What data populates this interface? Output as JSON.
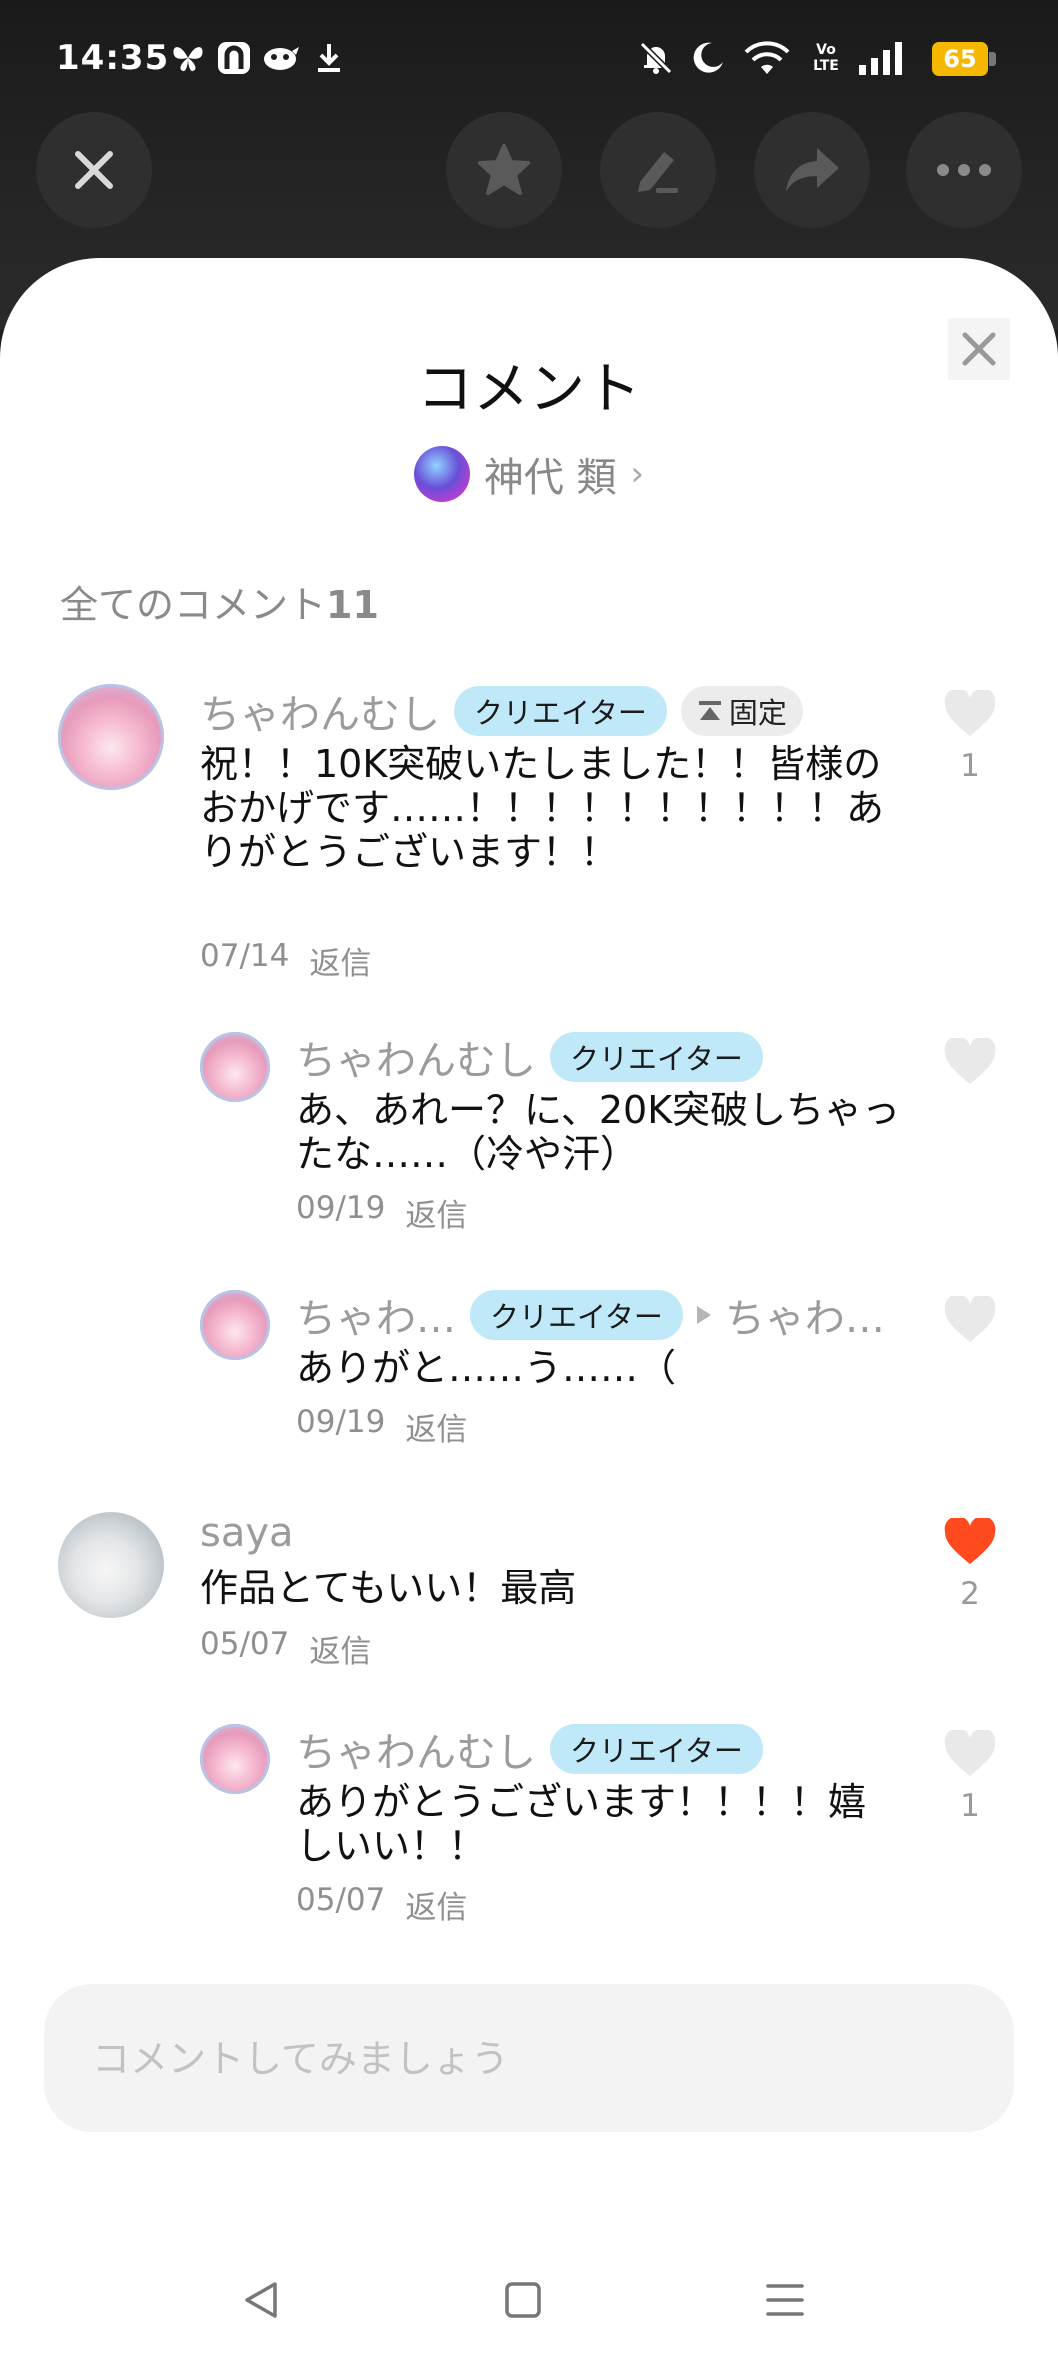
{
  "status_bar": {
    "time": "14:35",
    "battery": "65",
    "icons": [
      "butterfly-icon",
      "app-icon",
      "bird-icon",
      "download-icon",
      "mute-icon",
      "moon-icon",
      "wifi-icon",
      "volte-icon",
      "signal-icon",
      "battery-icon"
    ],
    "volte_text": "Vo LTE"
  },
  "top_actions": [
    "close-icon",
    "star-icon",
    "edit-icon",
    "share-icon",
    "more-icon"
  ],
  "sheet": {
    "title": "コメント",
    "author_name": "神代 類",
    "count_label": "全てのコメント",
    "count_value": "11"
  },
  "badges": {
    "creator": "クリエイター",
    "pinned": "固定"
  },
  "comments": [
    {
      "user": "ちゃわんむし",
      "text": "祝！！10K突破いたしました！！皆様のおかげです……！！！！！！！！！！ありがとうございます！！",
      "date": "07/14",
      "reply_label": "返信",
      "likes": "1",
      "replies": [
        {
          "user": "ちゃわんむし",
          "text": "あ、あれー？に、20K突破しちゃったな……（冷や汗）",
          "date": "09/19",
          "reply_label": "返信"
        },
        {
          "user": "ちゃわ…",
          "reply_to": "ちゃわ…",
          "text": "ありがと……う……（",
          "date": "09/19",
          "reply_label": "返信"
        }
      ]
    },
    {
      "user": "saya",
      "text": "作品とてもいい！最高",
      "date": "05/07",
      "reply_label": "返信",
      "likes": "2",
      "liked": true,
      "replies": [
        {
          "user": "ちゃわんむし",
          "text": "ありがとうございます！！！！嬉しいい！！",
          "date": "05/07",
          "reply_label": "返信",
          "likes": "1"
        }
      ]
    }
  ],
  "input": {
    "placeholder": "コメントしてみましょう",
    "value": ""
  },
  "nav": [
    "back-icon",
    "home-icon",
    "menu-icon"
  ],
  "colors": {
    "like_active": "#fe4a1e",
    "badge_bg": "#bfe8f8",
    "battery": "#f5b800"
  }
}
